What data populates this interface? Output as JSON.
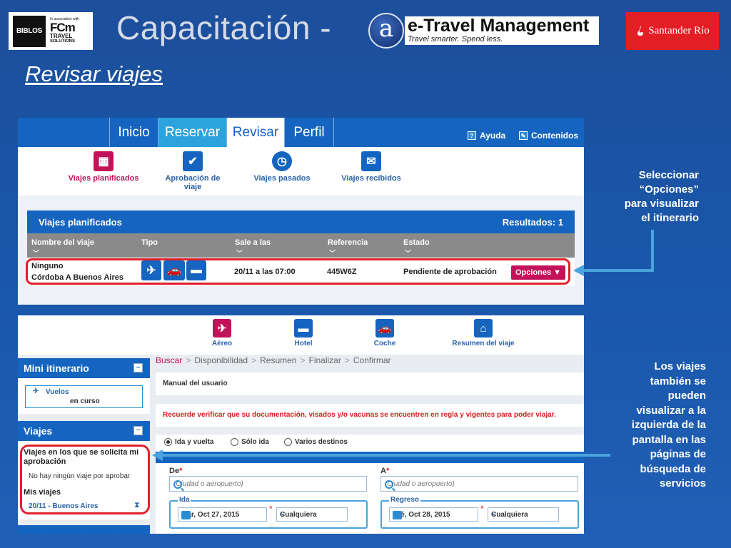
{
  "header": {
    "biblos_label": "BIBLOS",
    "fcm_assoc": "In association with",
    "fcm_label": "FCm",
    "fcm_travel": "TRAVEL",
    "fcm_solutions": "SOLUTIONS",
    "title": "Capacitación -",
    "a_logo": "a",
    "etm_title": "e-Travel Management",
    "etm_tagline": "Travel smarter. Spend less.",
    "santander": "Santander Río"
  },
  "slide_title": "Revisar viajes",
  "panel1": {
    "tabs": [
      "Inicio",
      "Reservar",
      "Revisar",
      "Perfil"
    ],
    "help": "Ayuda",
    "contents": "Contenidos",
    "subnav": [
      "Viajes planificados",
      "Aprobación de viaje",
      "Viajes pasados",
      "Viajes recibidos"
    ],
    "table_title": "Viajes planificados",
    "results": "Resultados: 1",
    "columns": [
      "Nombre del viaje",
      "Tipo",
      "Sale a las",
      "Referencia",
      "Estado"
    ],
    "row": {
      "name_line1": "Ninguno",
      "name_line2": "Córdoba A Buenos Aires",
      "departure": "20/11 a las 07:00",
      "reference": "445W6Z",
      "status": "Pendiente de aprobación",
      "options": "Opciones ▼"
    }
  },
  "panel2": {
    "icons": [
      "Aéreo",
      "Hotel",
      "Coche",
      "Resumen del viaje"
    ],
    "mini_itinerary": "Mini itinerario",
    "flights": "Vuelos",
    "in_progress": "en curso",
    "trips": "Viajes",
    "approval_title": "Viajes en los que se solicita mi aprobación",
    "no_trips": "No hay ningún viaje por aprobar",
    "my_trips": "Mis viajes",
    "my_trip_item": "20/11 - Buenos Aires",
    "breadcrumbs": [
      "Buscar",
      "Disponibilidad",
      "Resumen",
      "Finalizar",
      "Confirmar"
    ],
    "manual": "Manual del usuario",
    "warning": "Recuerde verificar que su documentación, visados y/o vacunas se encuentren en regla y vigentes para poder viajar.",
    "radios": [
      "Ida y vuelta",
      "Sólo ida",
      "Varios destinos"
    ],
    "from_label": "De",
    "to_label": "A",
    "placeholder": "(Ciudad o aeropuerto)",
    "ida_label": "Ida",
    "ida_date": "Mar, Oct 27, 2015",
    "regreso_label": "Regreso",
    "regreso_date": "Mié, Oct 28, 2015",
    "any_time": "Cualquiera"
  },
  "annotations": {
    "first": [
      "Seleccionar",
      "“Opciones”",
      "para visualizar",
      "el itinerario"
    ],
    "second": [
      "Los viajes",
      "también se",
      "pueden",
      "visualizar a la",
      "izquierda de la",
      "pantalla en las",
      "páginas de",
      "búsqueda de",
      "servicios"
    ]
  },
  "colors": {
    "background": "#1a57aa",
    "app_blue": "#1565c0",
    "accent_magenta": "#c4125a",
    "highlight_red": "#e0202a",
    "callout_arrow": "#4aa3dd"
  }
}
